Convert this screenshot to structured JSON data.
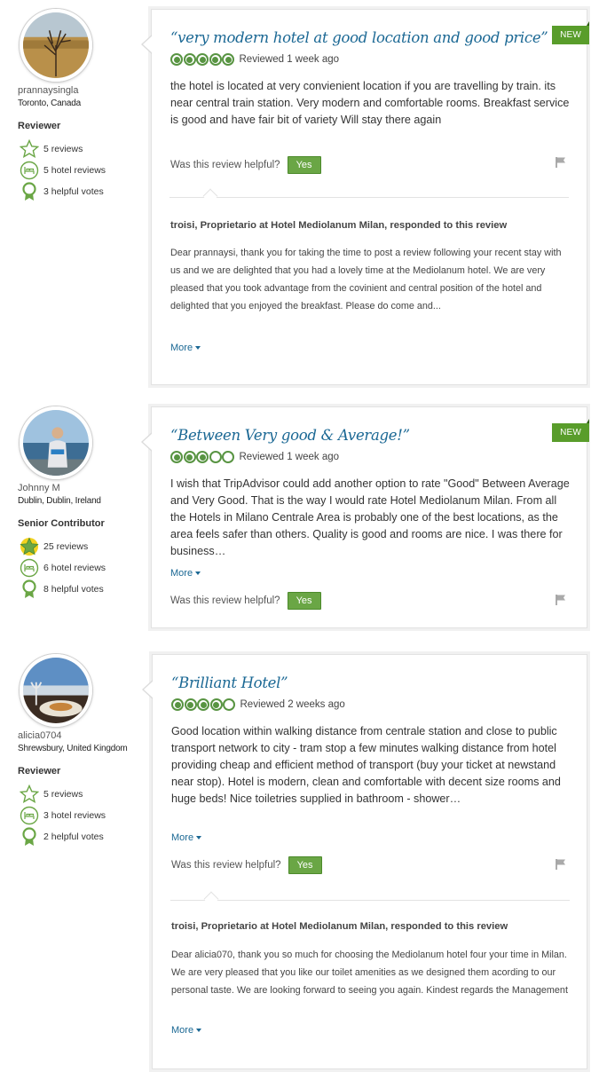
{
  "reviews": [
    {
      "user": {
        "name": "prannaysingla",
        "location": "Toronto, Canada",
        "level": "Reviewer",
        "badges": [
          {
            "icon": "star-outline-icon",
            "label": "5 reviews"
          },
          {
            "icon": "hotel-icon",
            "label": "5 hotel reviews"
          },
          {
            "icon": "ribbon-icon",
            "label": "3 helpful votes"
          }
        ]
      },
      "is_new": true,
      "new_label": "NEW",
      "title": "“very modern hotel at good location and good price”",
      "rating": 5,
      "reviewed": "Reviewed 1 week ago",
      "body": "the hotel is located at very convienient location if you are travelling by train. its near central train station. Very modern and comfortable rooms. Breakfast service is good and have fair bit of variety Will stay there again",
      "helpful_label": "Was this review helpful?",
      "yes_label": "Yes",
      "response": {
        "responder": "troisi, Proprietario at Hotel Mediolanum Milan, responded to this review",
        "text": "Dear prannaysi, thank you for taking the time to post a review following your recent stay with us and we are delighted that you had a lovely time at the Mediolanum hotel. We are very pleased that you took advantage from the covinient and central position of the hotel and delighted that you enjoyed the breakfast. Please do come and...",
        "more_label": "More"
      }
    },
    {
      "user": {
        "name": "Johnny M",
        "location": "Dublin, Dublin, Ireland",
        "level": "Senior Contributor",
        "badges": [
          {
            "icon": "star-filled-icon",
            "label": "25 reviews"
          },
          {
            "icon": "hotel-icon",
            "label": "6 hotel reviews"
          },
          {
            "icon": "ribbon-icon",
            "label": "8 helpful votes"
          }
        ]
      },
      "is_new": true,
      "new_label": "NEW",
      "title": "“Between Very good & Average!”",
      "rating": 3,
      "reviewed": "Reviewed 1 week ago",
      "body": "I wish that TripAdvisor could add another option to rate \"Good\" Between Average and Very Good. That is the way I would rate Hotel Mediolanum Milan. From all the Hotels in Milano Centrale Area is probably one of the best locations, as the area feels safer than others. Quality is good and rooms are nice. I was there for business…",
      "more_label": "More",
      "helpful_label": "Was this review helpful?",
      "yes_label": "Yes"
    },
    {
      "user": {
        "name": "alicia0704",
        "location": "Shrewsbury, United Kingdom",
        "level": "Reviewer",
        "badges": [
          {
            "icon": "star-outline-icon",
            "label": "5 reviews"
          },
          {
            "icon": "hotel-icon",
            "label": "3 hotel reviews"
          },
          {
            "icon": "ribbon-icon",
            "label": "2 helpful votes"
          }
        ]
      },
      "is_new": false,
      "title": "“Brilliant Hotel”",
      "rating": 4,
      "reviewed": "Reviewed 2 weeks ago",
      "body": "Good location within walking distance from centrale station and close to public transport network to city - tram stop a few minutes walking distance from hotel providing cheap and efficient method of transport (buy your ticket at newstand near stop). Hotel is modern, clean and comfortable with decent size rooms and huge beds! Nice toiletries supplied in bathroom - shower…",
      "more_label": "More",
      "helpful_label": "Was this review helpful?",
      "yes_label": "Yes",
      "response": {
        "responder": "troisi, Proprietario at Hotel Mediolanum Milan, responded to this review",
        "text": "Dear alicia070, thank you so much for choosing the Mediolanum hotel four your time in Milan. We are very pleased that you like our toilet amenities as we designed them acording to our personal taste. We are looking forward to seeing you again. Kindest regards the Management",
        "more_label": "More"
      }
    }
  ],
  "colors": {
    "accent_blue": "#1b6894",
    "bubble_green": "#589442",
    "new_green": "#599d2b",
    "yes_green": "#6aa645"
  }
}
